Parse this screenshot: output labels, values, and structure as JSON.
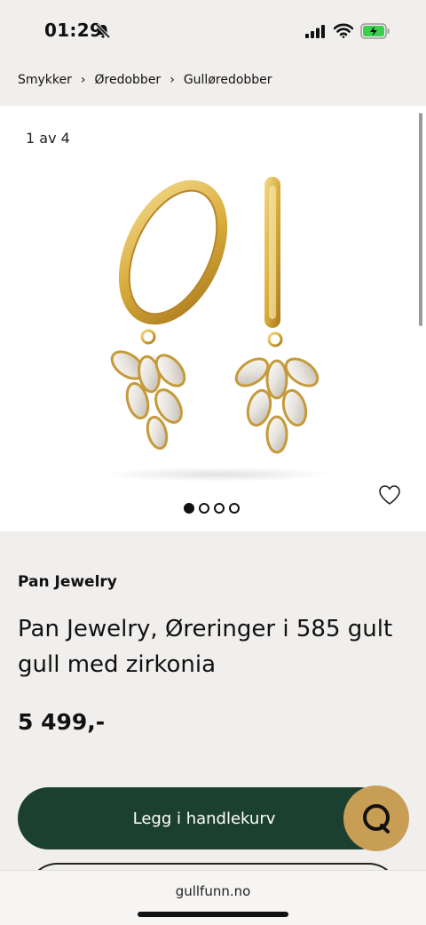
{
  "status_bar": {
    "time": "01:29"
  },
  "breadcrumb": [
    "Smykker",
    "Øredobber",
    "Gulløredobber"
  ],
  "gallery": {
    "counter": "1 av 4",
    "image_count": 4,
    "active_index": 0
  },
  "product": {
    "brand": "Pan Jewelry",
    "title": "Pan Jewelry, Øreringer i 585 gult gull med zirkonia",
    "price": "5 499,-"
  },
  "actions": {
    "add_to_cart_label": "Legg i handlekurv"
  },
  "browser": {
    "domain": "gullfunn.no"
  },
  "colors": {
    "button_green": "#1c4030",
    "chat_gold": "#c89e55",
    "background": "#f1efed"
  },
  "icons": [
    "bell-slash-icon",
    "signal-icon",
    "wifi-icon",
    "battery-charging-icon",
    "chevron-right-icon",
    "heart-icon",
    "chat-icon"
  ]
}
